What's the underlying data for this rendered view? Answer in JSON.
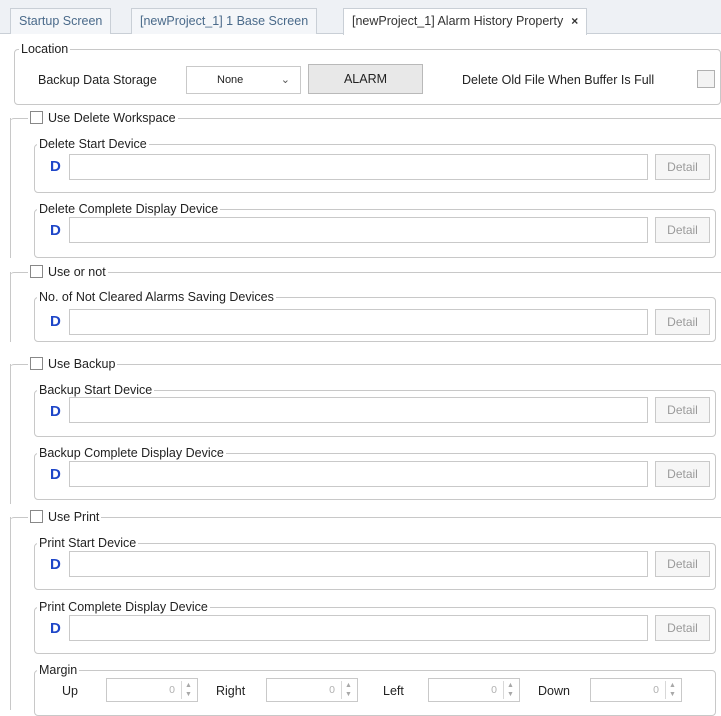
{
  "tabs": [
    {
      "label": "Startup Screen"
    },
    {
      "label": "[newProject_1] 1 Base Screen"
    },
    {
      "label": "[newProject_1] Alarm History Property",
      "close": "×"
    }
  ],
  "location": {
    "legend": "Location",
    "backup_label": "Backup Data Storage",
    "backup_value": "None",
    "alarm_button": "ALARM",
    "delete_old_label": "Delete Old File When Buffer Is Full"
  },
  "device_letter": "D",
  "detail_label": "Detail",
  "delete_ws": {
    "legend": "Use Delete Workspace",
    "start_legend": "Delete Start Device",
    "complete_legend": "Delete Complete Display Device"
  },
  "use_or_not": {
    "legend": "Use or not",
    "saving_legend": "No. of Not Cleared Alarms Saving Devices"
  },
  "backup": {
    "legend": "Use Backup",
    "start_legend": "Backup Start Device",
    "complete_legend": "Backup Complete Display Device"
  },
  "print": {
    "legend": "Use Print",
    "start_legend": "Print Start Device",
    "complete_legend": "Print Complete Display Device"
  },
  "margin": {
    "legend": "Margin",
    "up_label": "Up",
    "up_value": "0",
    "right_label": "Right",
    "right_value": "0",
    "left_label": "Left",
    "left_value": "0",
    "down_label": "Down",
    "down_value": "0"
  }
}
